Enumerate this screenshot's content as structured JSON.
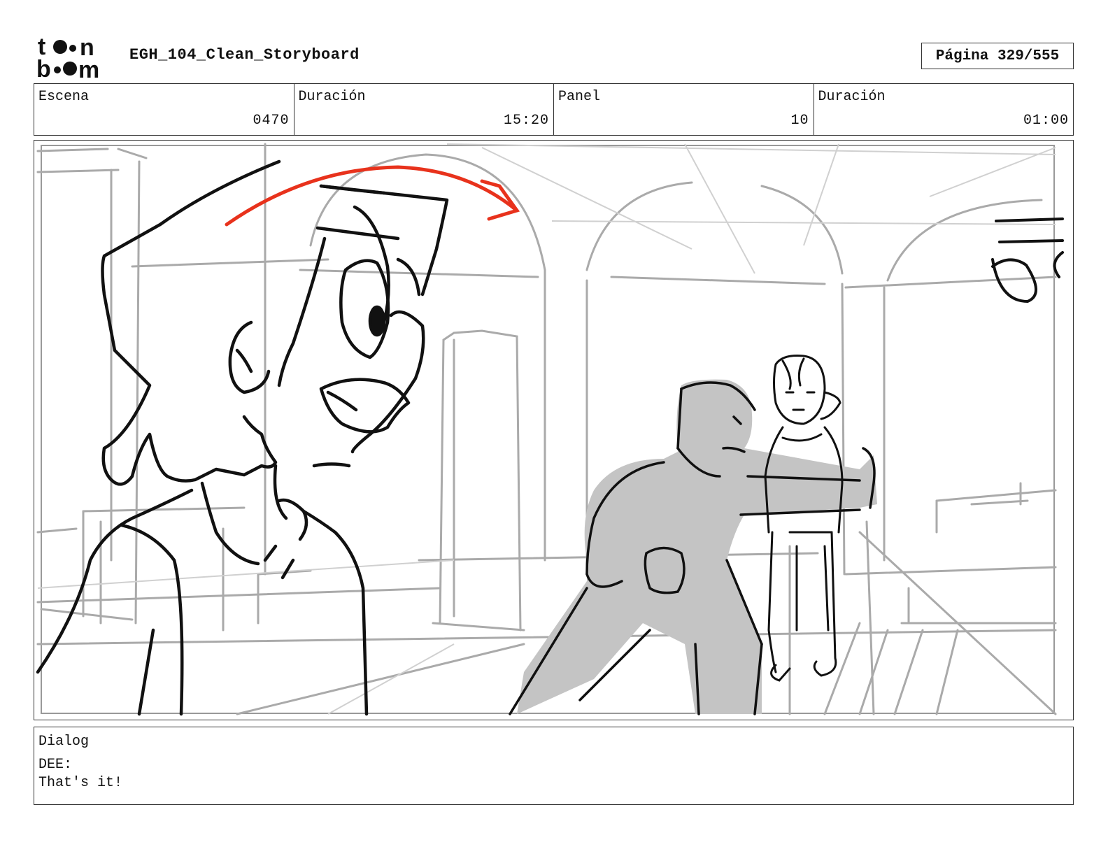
{
  "header": {
    "logo_text_top": "toon",
    "logo_text_bottom": "boom",
    "title": "EGH_104_Clean_Storyboard",
    "page_label": "Página",
    "page_number": "329/555"
  },
  "info": {
    "scene_label": "Escena",
    "scene_value": "0470",
    "scene_duration_label": "Duración",
    "scene_duration_value": "15:20",
    "panel_label": "Panel",
    "panel_value": "10",
    "panel_duration_label": "Duración",
    "panel_duration_value": "01:00"
  },
  "panel_image": {
    "description_icon": "storyboard-sketch",
    "arrow_color": "#e8321c",
    "fill_gray": "#c4c4c4"
  },
  "dialog": {
    "label": "Dialog",
    "speaker": "DEE:",
    "line": "That's it!"
  }
}
